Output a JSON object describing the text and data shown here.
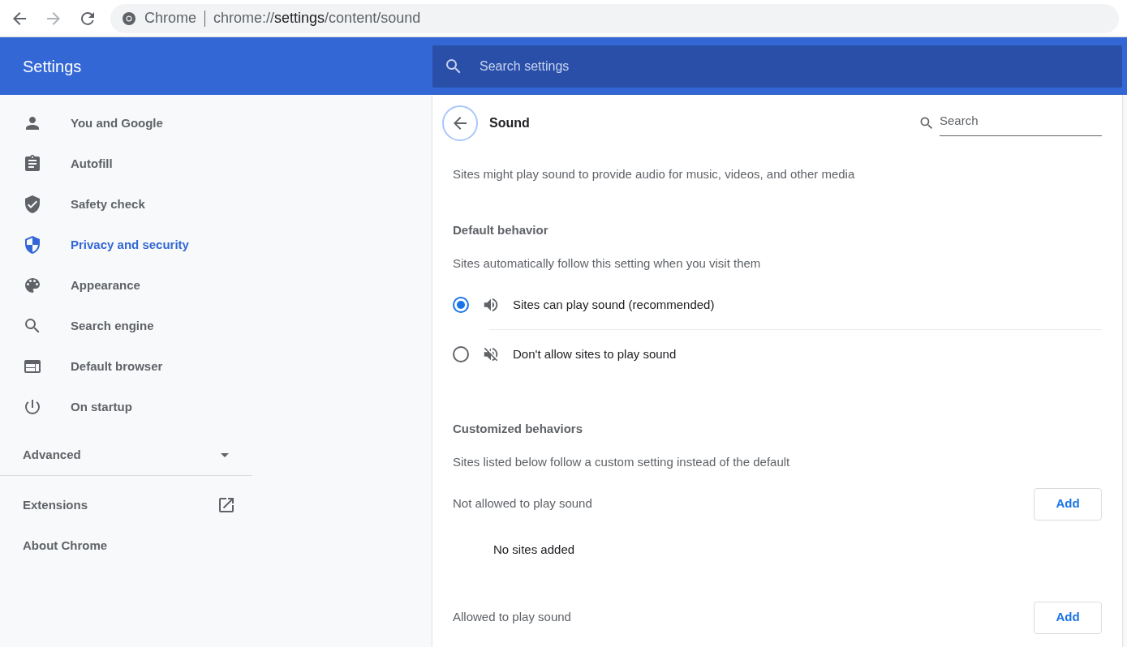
{
  "browser": {
    "site_label": "Chrome",
    "url_prefix": "chrome://",
    "url_host": "settings",
    "url_path": "/content/sound"
  },
  "header": {
    "title": "Settings",
    "search": {
      "placeholder": "Search settings"
    }
  },
  "sidebar": {
    "items": [
      {
        "label": "You and Google",
        "selected": false
      },
      {
        "label": "Autofill",
        "selected": false
      },
      {
        "label": "Safety check",
        "selected": false
      },
      {
        "label": "Privacy and security",
        "selected": true
      },
      {
        "label": "Appearance",
        "selected": false
      },
      {
        "label": "Search engine",
        "selected": false
      },
      {
        "label": "Default browser",
        "selected": false
      },
      {
        "label": "On startup",
        "selected": false
      }
    ],
    "advanced": {
      "label": "Advanced",
      "expanded": false
    },
    "links": [
      {
        "label": "Extensions",
        "external": true
      },
      {
        "label": "About Chrome",
        "external": false
      }
    ]
  },
  "page": {
    "title": "Sound",
    "search": {
      "placeholder": "Search"
    },
    "description": "Sites might play sound to provide audio for music, videos, and other media",
    "default_behavior": {
      "heading": "Default behavior",
      "description": "Sites automatically follow this setting when you visit them",
      "options": [
        {
          "label": "Sites can play sound (recommended)",
          "selected": true
        },
        {
          "label": "Don't allow sites to play sound",
          "selected": false
        }
      ]
    },
    "customized": {
      "heading": "Customized behaviors",
      "description": "Sites listed below follow a custom setting instead of the default",
      "lists": [
        {
          "title": "Not allowed to play sound",
          "button": "Add",
          "empty_text": "No sites added"
        },
        {
          "title": "Allowed to play sound",
          "button": "Add"
        }
      ]
    }
  }
}
